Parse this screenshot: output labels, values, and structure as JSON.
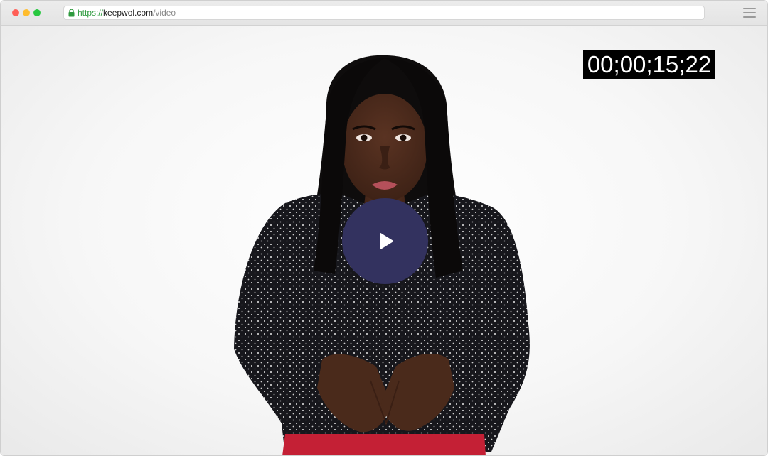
{
  "browser": {
    "url": {
      "scheme": "https://",
      "host": "keepwol.com",
      "path": "/video"
    },
    "traffic_lights": {
      "close": "#ff5f57",
      "minimize": "#febc2e",
      "maximize": "#28c840"
    },
    "icons": [
      "lock-icon",
      "hamburger-menu-icon"
    ]
  },
  "video": {
    "timecode": "00;00;15;22",
    "play_button_color": "#33325f",
    "icons": [
      "play-icon"
    ]
  }
}
